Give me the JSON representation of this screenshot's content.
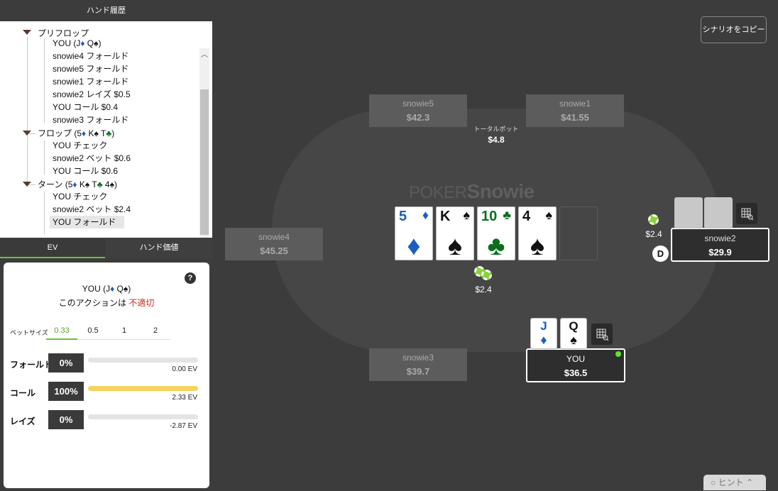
{
  "left_panel": {
    "title": "ハンド履歴",
    "tree": {
      "preflop": "プリフロップ",
      "preflop_items": [
        "snowie4 フォールド",
        "snowie5 フォールド",
        "snowie1 フォールド",
        "snowie2 レイズ $0.5",
        "YOU コール $0.4",
        "snowie3 フォールド"
      ],
      "you_hand_prefix": "YOU (J",
      "you_hand_mid": " Q",
      "you_hand_suffix": ")",
      "flop_prefix": "フロップ (5",
      "flop_k": " K",
      "flop_t": " T",
      "flop_items": [
        "YOU チェック",
        "snowie2 ベット $0.6",
        "YOU コール $0.6"
      ],
      "turn_prefix": "ターン (5",
      "turn_k": " K",
      "turn_t": " T",
      "turn_4": " 4",
      "turn_items": [
        "YOU チェック",
        "snowie2 ベット $2.4",
        "YOU フォールド"
      ],
      "paren_close": ")",
      "suit_diamond": "♦",
      "suit_spade": "♠",
      "suit_club": "♣"
    },
    "tabs": {
      "ev": "EV",
      "hand_value": "ハンド価値"
    },
    "ev_panel": {
      "help": "?",
      "hand_prefix": "YOU (J",
      "hand_mid": " Q",
      "hand_suffix": ")",
      "verdict_prefix": "このアクションは ",
      "verdict_bad": "不適切",
      "bet_size_label": "ベットサイズ",
      "bet_sizes": [
        "0.33",
        "0.5",
        "1",
        "2"
      ],
      "actions": [
        {
          "label": "フォールド",
          "pct": "0%",
          "fill": 0,
          "ev": "0.00 EV"
        },
        {
          "label": "コール",
          "pct": "100%",
          "fill": 1,
          "ev": "2.33 EV"
        },
        {
          "label": "レイズ",
          "pct": "0%",
          "fill": 0,
          "ev": "-2.87 EV"
        }
      ]
    }
  },
  "table": {
    "copy_scenario": "シナリオをコピー",
    "pot_label": "トータルポット",
    "pot_value": "$4.8",
    "logo": {
      "a": "POKER",
      "b": "Snowie"
    },
    "seats": {
      "snowie5": {
        "name": "snowie5",
        "stack": "$42.3"
      },
      "snowie1": {
        "name": "snowie1",
        "stack": "$41.55"
      },
      "snowie4": {
        "name": "snowie4",
        "stack": "$45.25"
      },
      "snowie2": {
        "name": "snowie2",
        "stack": "$29.9"
      },
      "snowie3": {
        "name": "snowie3",
        "stack": "$39.7"
      },
      "you": {
        "name": "YOU",
        "stack": "$36.5"
      }
    },
    "board": [
      {
        "rank": "5",
        "suit": "♦"
      },
      {
        "rank": "K",
        "suit": "♠"
      },
      {
        "rank": "10",
        "suit": "♣"
      },
      {
        "rank": "4",
        "suit": "♠"
      }
    ],
    "hole_cards": [
      {
        "rank": "J",
        "suit": "♦"
      },
      {
        "rank": "Q",
        "suit": "♠"
      }
    ],
    "bets": {
      "snowie2": "$2.4",
      "pot_chips": "$2.4"
    },
    "dealer": "D",
    "hint": "ヒント"
  }
}
